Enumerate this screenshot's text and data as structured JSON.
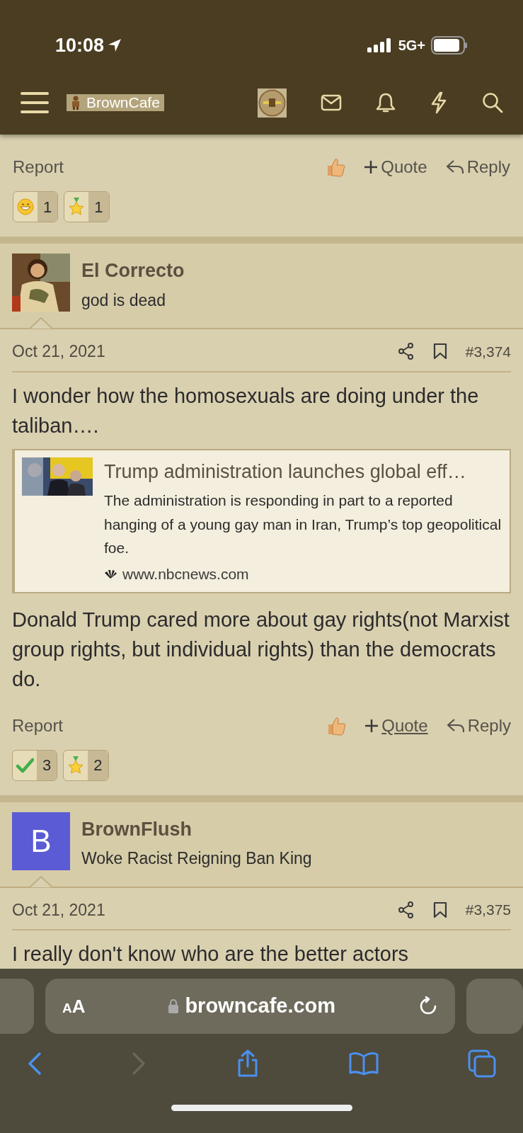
{
  "status_bar": {
    "time": "10:08",
    "network": "5G+"
  },
  "header": {
    "site_name": "BrownCafe"
  },
  "posts": [
    {
      "actions": {
        "report": "Report",
        "quote": "Quote",
        "reply": "Reply",
        "quote_underlined": false
      },
      "reactions": [
        {
          "kind": "grin",
          "count": "1"
        },
        {
          "kind": "star",
          "count": "1"
        }
      ]
    },
    {
      "author": {
        "name": "El Correcto",
        "title": "god is dead"
      },
      "date": "Oct 21, 2021",
      "number": "#3,374",
      "body": [
        "I wonder how the homosexuals are doing under the taliban….",
        {
          "kind": "link_preview",
          "title": "Trump administration launches global eff…",
          "description": "The administration is responding in part to a reported hanging of a young gay man in Iran, Trump’s top geopolitical foe.",
          "domain": "www.nbcnews.com"
        },
        "Donald Trump cared more about gay rights(not Marxist group rights, but individual rights) than the democrats do."
      ],
      "actions": {
        "report": "Report",
        "quote": "Quote",
        "reply": "Reply",
        "quote_underlined": true
      },
      "reactions": [
        {
          "kind": "check",
          "count": "3"
        },
        {
          "kind": "star",
          "count": "2"
        }
      ]
    },
    {
      "author": {
        "name": "BrownFlush",
        "title": "Woke Racist Reigning Ban King",
        "avatar": {
          "kind": "letter",
          "letter": "B",
          "color": "#5b5bd6"
        }
      },
      "date": "Oct 21, 2021",
      "number": "#3,375",
      "body": [
        "I really don't know who are the better actors"
      ]
    }
  ],
  "browser": {
    "text_size": "AA",
    "url": "browncafe.com",
    "back_disabled": false,
    "forward_disabled": true
  }
}
